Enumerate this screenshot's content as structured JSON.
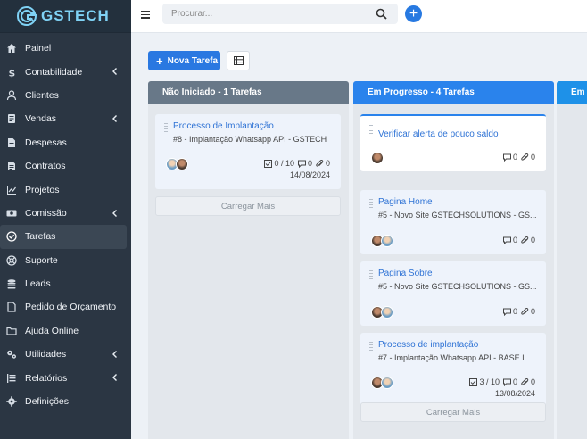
{
  "brand": {
    "name": "GSTECH"
  },
  "sidebar": {
    "items": [
      {
        "label": "Painel",
        "icon": "home-icon",
        "chevron": false
      },
      {
        "label": "Contabilidade",
        "icon": "dollar-icon",
        "chevron": true
      },
      {
        "label": "Clientes",
        "icon": "user-icon",
        "chevron": false
      },
      {
        "label": "Vendas",
        "icon": "receipt-icon",
        "chevron": true
      },
      {
        "label": "Despesas",
        "icon": "document-icon",
        "chevron": false
      },
      {
        "label": "Contratos",
        "icon": "contract-icon",
        "chevron": false
      },
      {
        "label": "Projetos",
        "icon": "chart-icon",
        "chevron": false
      },
      {
        "label": "Comissão",
        "icon": "money-icon",
        "chevron": true
      },
      {
        "label": "Tarefas",
        "icon": "check-circle-icon",
        "chevron": false,
        "active": true
      },
      {
        "label": "Suporte",
        "icon": "lifebuoy-icon",
        "chevron": false
      },
      {
        "label": "Leads",
        "icon": "leads-icon",
        "chevron": false
      },
      {
        "label": "Pedido de Orçamento",
        "icon": "file-icon",
        "chevron": false
      },
      {
        "label": "Ajuda Online",
        "icon": "folder-icon",
        "chevron": false
      },
      {
        "label": "Utilidades",
        "icon": "cogs-icon",
        "chevron": true
      },
      {
        "label": "Relatórios",
        "icon": "list-icon",
        "chevron": true
      },
      {
        "label": "Definições",
        "icon": "gear-icon",
        "chevron": false
      }
    ]
  },
  "header": {
    "search_placeholder": "Procurar...",
    "add_label": "+"
  },
  "toolbar": {
    "new_task_label": "Nova Tarefa"
  },
  "columns": [
    {
      "title": "Não Iniciado - 1 Tarefas",
      "cards": [
        {
          "title": "Processo de Implantação",
          "subtitle": "#8 - Implantação Whatsapp API - GSTECH",
          "checklist": "0 / 10",
          "comments": "0",
          "attachments": "0",
          "date": "14/08/2024",
          "avatars": [
            "b",
            "a"
          ]
        }
      ],
      "load_more": "Carregar Mais"
    },
    {
      "title": "Em Progresso - 4 Tarefas",
      "cards": [
        {
          "title": "Verificar alerta de pouco saldo",
          "subtitle": "",
          "checklist": "",
          "comments": "0",
          "attachments": "0",
          "date": "",
          "avatars": [
            "a"
          ]
        },
        {
          "title": "Pagina Home",
          "subtitle": "#5 - Novo Site GSTECHSOLUTIONS - GS...",
          "checklist": "",
          "comments": "0",
          "attachments": "0",
          "date": "",
          "avatars": [
            "a",
            "b"
          ]
        },
        {
          "title": "Pagina Sobre",
          "subtitle": "#5 - Novo Site GSTECHSOLUTIONS - GS...",
          "checklist": "",
          "comments": "0",
          "attachments": "0",
          "date": "",
          "avatars": [
            "a",
            "b"
          ]
        },
        {
          "title": "Processo de implantação",
          "subtitle": "#7 - Implantação Whatsapp API - BASE I...",
          "checklist": "3 / 10",
          "comments": "0",
          "attachments": "0",
          "date": "13/08/2024",
          "avatars": [
            "a",
            "b"
          ]
        }
      ],
      "load_more": "Carregar Mais"
    },
    {
      "title": "Em T"
    }
  ]
}
